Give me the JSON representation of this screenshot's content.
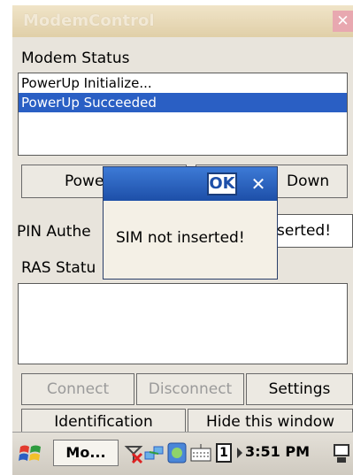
{
  "window": {
    "title": "ModemControl",
    "close_glyph": "✕"
  },
  "modem_status": {
    "label": "Modem Status",
    "log": [
      "PowerUp Initialize...",
      "PowerUp Succeeded"
    ],
    "selected_index": 1
  },
  "power": {
    "power_up_visible": "Powe",
    "power_down_visible": "Down"
  },
  "pin": {
    "label_visible": "PIN Authe",
    "value_visible": "serted!"
  },
  "ras": {
    "label_visible": "RAS Statu"
  },
  "buttons": {
    "connect": "Connect",
    "disconnect": "Disconnect",
    "settings": "Settings",
    "identification": "Identification",
    "hide": "Hide this window"
  },
  "dialog": {
    "ok_label": "OK",
    "close_glyph": "✕",
    "message": "SIM not inserted!"
  },
  "taskbar": {
    "app_label": "Mo...",
    "time": "3:51 PM",
    "counter": "1",
    "icons": [
      "windows-start-icon",
      "no-signal-icon",
      "network-icon",
      "sync-icon",
      "keyboard-icon",
      "arrow-icon",
      "screen-icon"
    ]
  },
  "colors": {
    "selection": "#2a5fc4",
    "dialog_title": "#1d4fa8",
    "window_bg": "#e8e4dc"
  }
}
